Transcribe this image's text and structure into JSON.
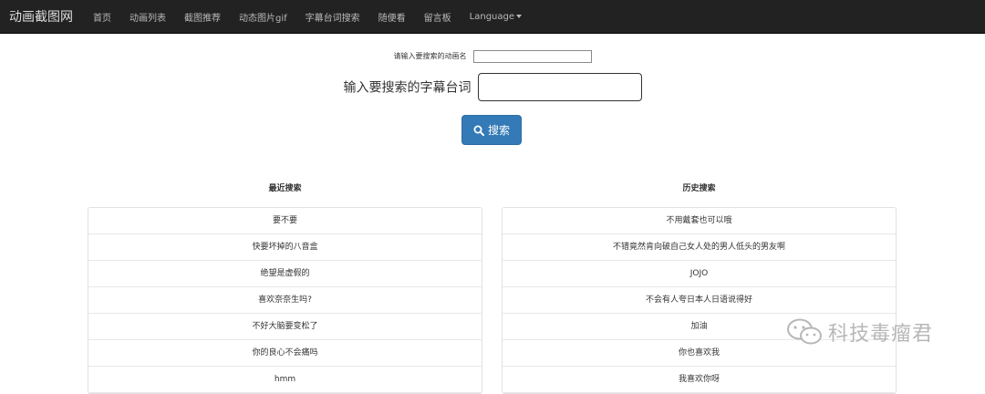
{
  "navbar": {
    "brand": "动画截图网",
    "items": [
      "首页",
      "动画列表",
      "截图推荐",
      "动态图片gif",
      "字幕台词搜索",
      "随便看",
      "留言板"
    ],
    "language": "Language"
  },
  "search": {
    "anime_label": "请输入要搜索的动画名",
    "anime_value": "",
    "subtitle_label": "输入要搜索的字幕台词",
    "subtitle_value": "",
    "button_label": "搜索"
  },
  "recent": {
    "title": "最近搜索",
    "items": [
      "要不要",
      "快要坏掉的八音盒",
      "绝望是虚假的",
      "喜欢奈奈生吗?",
      "不好大脑要变松了",
      "你的良心不会痛吗",
      "hmm"
    ]
  },
  "history": {
    "title": "历史搜索",
    "items": [
      "不用戴套也可以哦",
      "不错竟然肯向破自己女人处的男人低头的男友啊",
      "JOJO",
      "不会有人夸日本人日语说得好",
      "加油",
      "你也喜欢我",
      "我喜欢你呀"
    ]
  },
  "watermark": {
    "text": "科技毒瘤君"
  },
  "colors": {
    "navbar": "#222222",
    "primary": "#337ab7"
  }
}
